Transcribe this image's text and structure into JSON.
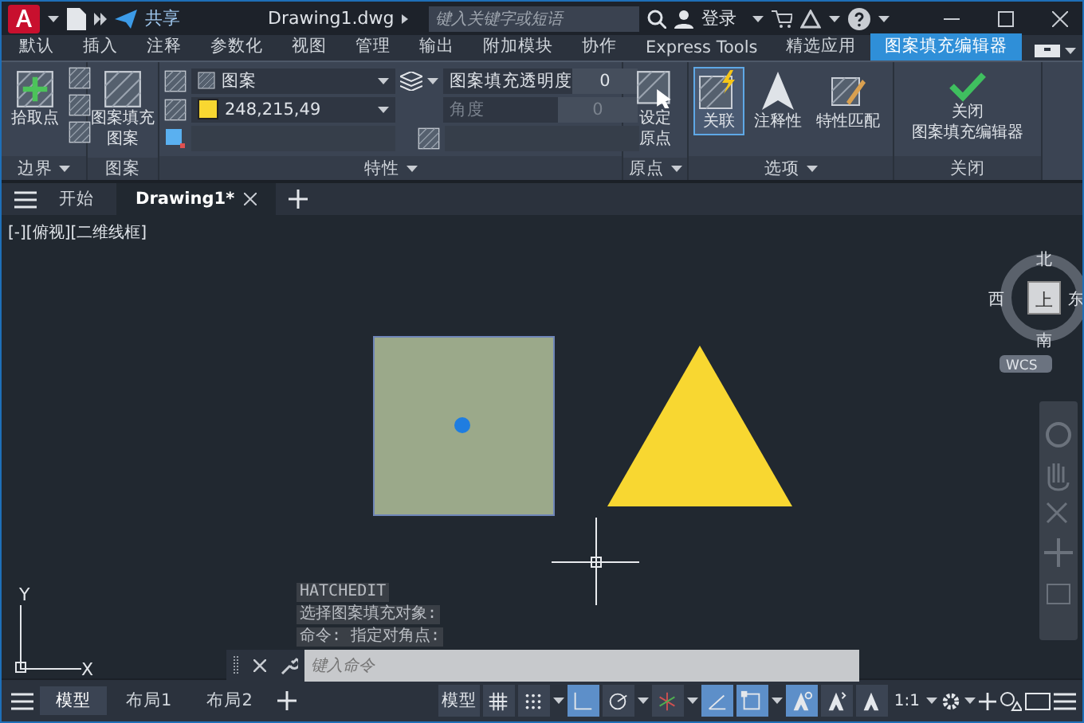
{
  "title_bar": {
    "share_label": "共享",
    "file_name": "Drawing1.dwg",
    "search_placeholder": "键入关键字或短语",
    "sign_in": "登录"
  },
  "ribbon_tabs": [
    {
      "label": "默认",
      "selected": false
    },
    {
      "label": "插入",
      "selected": false
    },
    {
      "label": "注释",
      "selected": false
    },
    {
      "label": "参数化",
      "selected": false
    },
    {
      "label": "视图",
      "selected": false
    },
    {
      "label": "管理",
      "selected": false
    },
    {
      "label": "输出",
      "selected": false
    },
    {
      "label": "附加模块",
      "selected": false
    },
    {
      "label": "协作",
      "selected": false
    },
    {
      "label": "Express Tools",
      "selected": false
    },
    {
      "label": "精选应用",
      "selected": false
    },
    {
      "label": "图案填充编辑器",
      "selected": true
    }
  ],
  "ribbon": {
    "boundary": {
      "title": "边界",
      "pick_points": "拾取点"
    },
    "pattern": {
      "title": "图案",
      "button": [
        "图案填充",
        "图案"
      ]
    },
    "properties": {
      "title": "特性",
      "pattern_type": "图案",
      "color_value": "248,215,49",
      "color": "#f8d731",
      "transparency_label": "图案填充透明度",
      "transparency_value": "0",
      "angle_label": "角度",
      "angle_value": "0",
      "angle_disabled": true
    },
    "origin": {
      "title": "原点",
      "button": [
        "设定",
        "原点"
      ]
    },
    "options": {
      "title": "选项",
      "buttons": [
        {
          "kind": "associative",
          "label": "关联",
          "selected": true
        },
        {
          "kind": "annotative",
          "label": "注释性",
          "selected": false
        },
        {
          "kind": "match",
          "label": "特性匹配",
          "selected": false
        }
      ]
    },
    "close": {
      "title": "关闭",
      "button": [
        "关闭",
        "图案填充编辑器"
      ]
    }
  },
  "file_tabs": [
    {
      "label": "开始",
      "selected": false
    },
    {
      "label": "Drawing1*",
      "selected": true
    }
  ],
  "viewport_label": "[-][俯视][二维线框]",
  "viewcube": {
    "north": "北",
    "south": "南",
    "east": "东",
    "west": "西",
    "face": "上",
    "wcs": "WCS"
  },
  "ucs": {
    "x": "X",
    "y": "Y"
  },
  "command_history": [
    "HATCHEDIT",
    "选择图案填充对象:",
    "命令: 指定对角点:"
  ],
  "command_input": {
    "placeholder": "键入命令"
  },
  "layout_tabs": [
    {
      "label": "模型",
      "selected": true
    },
    {
      "label": "布局1",
      "selected": false
    },
    {
      "label": "布局2",
      "selected": false
    }
  ],
  "status_bar": {
    "model_button": "模型",
    "scale": "1:1",
    "tools": [
      {
        "kind": "grid",
        "on": false,
        "dropdown": false
      },
      {
        "kind": "snap",
        "on": false,
        "dropdown": true
      },
      {
        "kind": "ortho",
        "on": true,
        "dropdown": false
      },
      {
        "kind": "polar",
        "on": false,
        "dropdown": true
      },
      {
        "kind": "isodraft",
        "on": false,
        "dropdown": true
      },
      {
        "kind": "tracking",
        "on": true,
        "dropdown": false
      },
      {
        "kind": "osnap",
        "on": true,
        "dropdown": true
      },
      {
        "kind": "annotation",
        "on": true,
        "dropdown": false
      },
      {
        "kind": "autoscale",
        "on": false,
        "dropdown": false
      },
      {
        "kind": "annoscale",
        "on": false,
        "dropdown": false
      }
    ]
  }
}
